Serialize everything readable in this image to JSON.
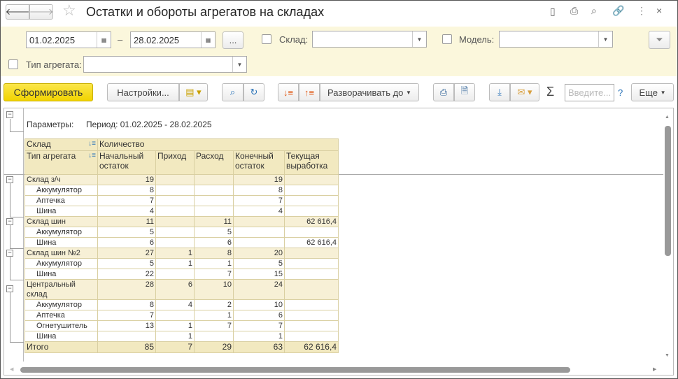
{
  "window": {
    "title": "Остатки и обороты агрегатов на складах"
  },
  "filters": {
    "date_from": "01.02.2025",
    "date_separator": "–",
    "date_to": "28.02.2025",
    "period_button": "...",
    "warehouse_label": "Склад:",
    "warehouse_value": "",
    "model_label": "Модель:",
    "model_value": "",
    "unit_type_label": "Тип агрегата:",
    "unit_type_value": ""
  },
  "toolbar": {
    "generate": "Сформировать",
    "settings": "Настройки...",
    "expand_to": "Разворачивать до",
    "search_placeholder": "Введите...",
    "help": "?",
    "more": "Еще",
    "sum": "Σ"
  },
  "report": {
    "params_label": "Параметры:",
    "params_value": "Период: 01.02.2025 - 28.02.2025",
    "header": {
      "group1": "Склад",
      "group2": "Тип агрегата",
      "quantity": "Количество",
      "columns": [
        "Начальный остаток",
        "Приход",
        "Расход",
        "Конечный остаток",
        "Текущая выработка"
      ]
    },
    "rows": [
      {
        "type": "grp",
        "name": "Склад з/ч",
        "values": [
          "19",
          "",
          "",
          "19",
          ""
        ]
      },
      {
        "type": "item",
        "name": "Аккумулятор",
        "values": [
          "8",
          "",
          "",
          "8",
          ""
        ]
      },
      {
        "type": "item",
        "name": "Аптечка",
        "values": [
          "7",
          "",
          "",
          "7",
          ""
        ]
      },
      {
        "type": "item",
        "name": "Шина",
        "values": [
          "4",
          "",
          "",
          "4",
          ""
        ]
      },
      {
        "type": "grp",
        "name": "Склад шин",
        "values": [
          "11",
          "",
          "11",
          "",
          "62 616,4"
        ]
      },
      {
        "type": "item",
        "name": "Аккумулятор",
        "values": [
          "5",
          "",
          "5",
          "",
          ""
        ]
      },
      {
        "type": "item",
        "name": "Шина",
        "values": [
          "6",
          "",
          "6",
          "",
          "62 616,4"
        ]
      },
      {
        "type": "grp",
        "name": "Склад шин №2",
        "values": [
          "27",
          "1",
          "8",
          "20",
          ""
        ]
      },
      {
        "type": "item",
        "name": "Аккумулятор",
        "values": [
          "5",
          "1",
          "1",
          "5",
          ""
        ]
      },
      {
        "type": "item",
        "name": "Шина",
        "values": [
          "22",
          "",
          "7",
          "15",
          ""
        ]
      },
      {
        "type": "grp",
        "name": "Центральный склад",
        "values": [
          "28",
          "6",
          "10",
          "24",
          ""
        ]
      },
      {
        "type": "item",
        "name": "Аккумулятор",
        "values": [
          "8",
          "4",
          "2",
          "10",
          ""
        ]
      },
      {
        "type": "item",
        "name": "Аптечка",
        "values": [
          "7",
          "",
          "1",
          "6",
          ""
        ]
      },
      {
        "type": "item",
        "name": "Огнетушитель",
        "values": [
          "13",
          "1",
          "7",
          "7",
          ""
        ]
      },
      {
        "type": "item",
        "name": "Шина",
        "values": [
          "",
          "1",
          "",
          "1",
          ""
        ]
      }
    ],
    "total": {
      "name": "Итого",
      "values": [
        "85",
        "7",
        "29",
        "63",
        "62 616,4"
      ]
    }
  },
  "colors": {
    "accent_yellow": "#f5d800",
    "filter_bg": "#fbf7dc",
    "table_header": "#f2e9c0"
  }
}
